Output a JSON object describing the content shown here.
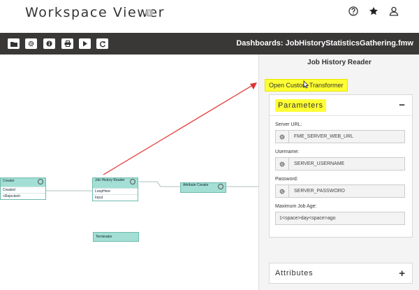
{
  "app": {
    "title": "Workspace Viewer"
  },
  "header": {
    "info_icon": "info-icon",
    "icons": [
      "help-icon",
      "star-icon",
      "user-icon"
    ]
  },
  "toolbar": {
    "buttons": [
      "folder-icon",
      "gear-icon",
      "info-icon",
      "print-icon",
      "play-icon",
      "refresh-icon"
    ],
    "dashboard_title": "Dashboards: JobHistoryStatisticsGathering.fmw"
  },
  "canvas": {
    "nodes": {
      "creator": {
        "title": "Creator",
        "ports": [
          "Created",
          "<Rejected>"
        ]
      },
      "job_history_reader": {
        "title": "Job History Reader",
        "ports": [
          "LoopHere",
          "Input"
        ]
      },
      "attribute_creator": {
        "title": "Attribute Creator"
      },
      "terminator": {
        "title": "Terminator"
      }
    },
    "arrow_color": "#e03030"
  },
  "panel": {
    "title": "Job History Reader",
    "open_button": "Open Custom Transformer",
    "parameters": {
      "title": "Parameters",
      "toggle": "−",
      "fields": [
        {
          "label": "Server URL:",
          "value": "FME_SERVER_WEB_URL"
        },
        {
          "label": "Username:",
          "value": "SERVER_USERNAME"
        },
        {
          "label": "Password:",
          "value": "SERVER_PASSWORD"
        },
        {
          "label": "Maximum Job Age:",
          "value": "1<space>day<space>ago"
        }
      ]
    },
    "attributes": {
      "title": "Attributes",
      "toggle": "+"
    }
  },
  "colors": {
    "highlight": "#ffff33",
    "node_fill": "#a3dfd4",
    "toolbar_bg": "#3a3737"
  }
}
